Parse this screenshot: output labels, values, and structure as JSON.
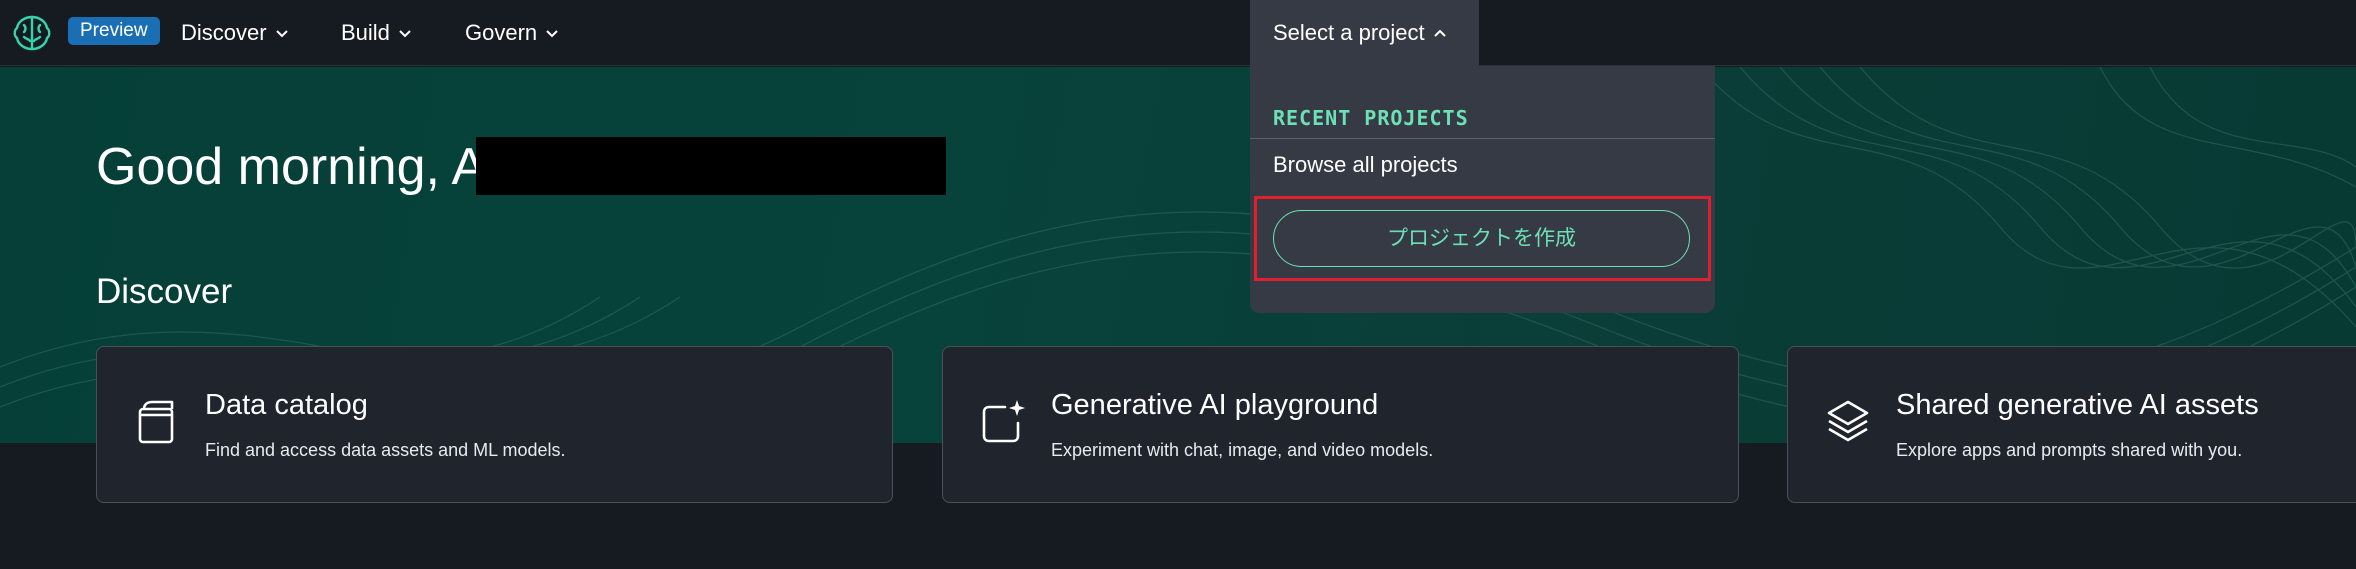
{
  "nav": {
    "badge": "Preview",
    "items": [
      {
        "label": "Discover"
      },
      {
        "label": "Build"
      },
      {
        "label": "Govern"
      }
    ],
    "project_select": "Select a project"
  },
  "hero": {
    "greeting": "Good morning, A",
    "section_title": "Discover"
  },
  "cards": [
    {
      "icon": "book-icon",
      "title": "Data catalog",
      "desc": "Find and access data assets and ML models."
    },
    {
      "icon": "sparkle-chat-icon",
      "title": "Generative AI playground",
      "desc": "Experiment with chat, image, and video models."
    },
    {
      "icon": "layers-icon",
      "title": "Shared generative AI assets",
      "desc": "Explore apps and prompts shared with you."
    }
  ],
  "dropdown": {
    "header": "RECENT PROJECTS",
    "browse": "Browse all projects",
    "create": "プロジェクトを作成"
  },
  "colors": {
    "accent": "#6ee0b6",
    "badge": "#1a6fb4",
    "highlight": "#e0202e"
  }
}
